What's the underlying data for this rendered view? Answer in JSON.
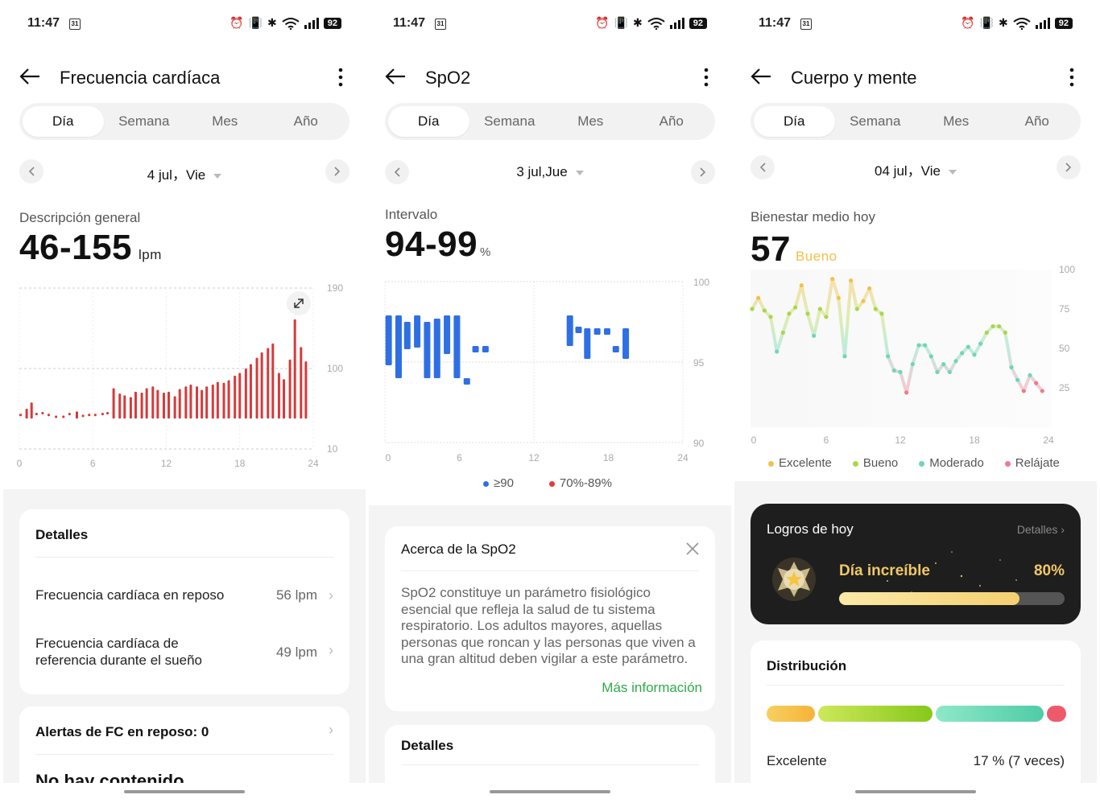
{
  "status": {
    "time": "11:47",
    "cal": "31",
    "battery": "92"
  },
  "screens": {
    "hr": {
      "title": "Frecuencia cardíaca",
      "tabs": [
        "Día",
        "Semana",
        "Mes",
        "Año"
      ],
      "date": "4 jul，Vie",
      "overview_label": "Descripción general",
      "range": "46-155",
      "unit": "lpm",
      "y_ticks": [
        "190",
        "100",
        "10"
      ],
      "x_ticks": [
        "0",
        "6",
        "12",
        "18",
        "24"
      ],
      "details_title": "Detalles",
      "rows": [
        {
          "label": "Frecuencia cardíaca en reposo",
          "value": "56 lpm"
        },
        {
          "label": "Frecuencia cardíaca de referencia durante el sueño",
          "value": "49 lpm"
        }
      ],
      "alerts_title": "Alertas de FC en reposo: 0",
      "no_content": "No hay contenido"
    },
    "spo2": {
      "title": "SpO2",
      "tabs": [
        "Día",
        "Semana",
        "Mes",
        "Año"
      ],
      "date": "3 jul,Jue",
      "interval_label": "Intervalo",
      "range": "94-99",
      "unit": "%",
      "y_ticks": [
        "100",
        "95",
        "90"
      ],
      "x_ticks": [
        "0",
        "6",
        "12",
        "18",
        "24"
      ],
      "legend": [
        {
          "label": "≥90",
          "color": "#2f6fe4"
        },
        {
          "label": "70%-89%",
          "color": "#e23b3b"
        }
      ],
      "about_title": "Acerca de la SpO2",
      "about_text": "SpO2 constituye un parámetro fisiológico esencial que refleja la salud de tu sistema respiratorio. Los adultos mayores, aquellas personas que roncan y las personas que viven a una gran altitud deben vigilar a este parámetro.",
      "more_info": "Más información",
      "details_title": "Detalles"
    },
    "body": {
      "title": "Cuerpo y mente",
      "tabs": [
        "Día",
        "Semana",
        "Mes",
        "Año"
      ],
      "date": "04 jul，Vie",
      "avg_label": "Bienestar medio hoy",
      "score": "57",
      "score_label": "Bueno",
      "y_ticks": [
        "100",
        "75",
        "50",
        "25"
      ],
      "x_ticks": [
        "0",
        "6",
        "12",
        "18",
        "24"
      ],
      "legend": [
        {
          "label": "Excelente",
          "color": "#f5c04a"
        },
        {
          "label": "Bueno",
          "color": "#a8d84a"
        },
        {
          "label": "Moderado",
          "color": "#6fd6b8"
        },
        {
          "label": "Relájate",
          "color": "#f07a8e"
        }
      ],
      "achievements_title": "Logros de hoy",
      "achievements_link": "Detalles",
      "achievement_name": "Día increíble",
      "achievement_pct": "80%",
      "achievement_progress": 0.8,
      "distribution_title": "Distribución",
      "distribution_row_label": "Excelente",
      "distribution_row_value": "17 % (7 veces)"
    }
  },
  "chart_data": [
    {
      "type": "bar",
      "ylim": [
        10,
        190
      ],
      "x_range": [
        0,
        24
      ],
      "values_note_points": [
        [
          0.1,
          48
        ],
        [
          0.6,
          55
        ],
        [
          1.0,
          62
        ],
        [
          1.4,
          49
        ],
        [
          1.9,
          50
        ],
        [
          2.4,
          48
        ],
        [
          3.0,
          46
        ],
        [
          3.6,
          46
        ],
        [
          4.1,
          49
        ],
        [
          4.7,
          52
        ],
        [
          5.2,
          47
        ],
        [
          5.7,
          48
        ],
        [
          6.2,
          48
        ],
        [
          6.8,
          49
        ],
        [
          7.2,
          50
        ],
        [
          7.7,
          78
        ],
        [
          8.2,
          72
        ],
        [
          8.6,
          70
        ],
        [
          9.1,
          68
        ],
        [
          9.5,
          74
        ],
        [
          10.0,
          73
        ],
        [
          10.4,
          78
        ],
        [
          10.9,
          80
        ],
        [
          11.3,
          76
        ],
        [
          11.8,
          73
        ],
        [
          12.2,
          74
        ],
        [
          12.7,
          69
        ],
        [
          13.1,
          77
        ],
        [
          13.6,
          80
        ],
        [
          14.0,
          82
        ],
        [
          14.5,
          80
        ],
        [
          14.9,
          76
        ],
        [
          15.3,
          80
        ],
        [
          15.8,
          82
        ],
        [
          16.2,
          85
        ],
        [
          16.7,
          84
        ],
        [
          17.1,
          87
        ],
        [
          17.6,
          92
        ],
        [
          18.0,
          95
        ],
        [
          18.5,
          100
        ],
        [
          18.9,
          105
        ],
        [
          19.4,
          112
        ],
        [
          19.8,
          118
        ],
        [
          20.3,
          123
        ],
        [
          20.7,
          128
        ],
        [
          21.2,
          95
        ],
        [
          21.6,
          88
        ],
        [
          22.1,
          110
        ],
        [
          22.5,
          155
        ],
        [
          23.0,
          124
        ],
        [
          23.4,
          108
        ]
      ]
    },
    {
      "type": "bar",
      "ylim": [
        90,
        100
      ],
      "x_range": [
        0,
        24
      ],
      "ranges": [
        [
          0.3,
          97.9,
          94.8
        ],
        [
          1.1,
          97.9,
          94.0
        ],
        [
          1.8,
          97.5,
          95.8
        ],
        [
          2.6,
          97.9,
          95.9
        ],
        [
          3.4,
          97.5,
          94.0
        ],
        [
          4.2,
          97.7,
          94.0
        ],
        [
          5.0,
          97.9,
          95.5
        ],
        [
          5.8,
          97.9,
          94.0
        ],
        [
          6.6,
          94.0,
          93.9
        ],
        [
          7.3,
          96.0,
          96.0
        ],
        [
          8.1,
          96.0,
          96.0
        ],
        [
          14.9,
          97.9,
          96.0
        ],
        [
          15.6,
          97.2,
          97.0
        ],
        [
          16.3,
          97.1,
          95.2
        ],
        [
          17.1,
          97.1,
          97.0
        ],
        [
          17.9,
          97.1,
          97.0
        ],
        [
          18.6,
          96.0,
          96.0
        ],
        [
          19.4,
          97.1,
          95.2
        ]
      ]
    },
    {
      "type": "line",
      "ylim": [
        0,
        100
      ],
      "x_range": [
        0,
        24
      ],
      "points": [
        [
          0.0,
          75
        ],
        [
          0.5,
          82
        ],
        [
          1.0,
          74
        ],
        [
          1.5,
          70
        ],
        [
          2.0,
          48
        ],
        [
          2.5,
          60
        ],
        [
          3.0,
          72
        ],
        [
          3.5,
          76
        ],
        [
          4.0,
          90
        ],
        [
          4.5,
          72
        ],
        [
          5.0,
          58
        ],
        [
          5.5,
          75
        ],
        [
          6.0,
          70
        ],
        [
          6.5,
          94
        ],
        [
          7.0,
          82
        ],
        [
          7.5,
          45
        ],
        [
          8.0,
          93
        ],
        [
          8.5,
          75
        ],
        [
          9.0,
          80
        ],
        [
          9.5,
          88
        ],
        [
          10.0,
          75
        ],
        [
          10.5,
          72
        ],
        [
          11.0,
          45
        ],
        [
          11.5,
          36
        ],
        [
          12.0,
          35
        ],
        [
          12.5,
          22
        ],
        [
          13.0,
          40
        ],
        [
          13.5,
          52
        ],
        [
          14.0,
          52
        ],
        [
          14.5,
          45
        ],
        [
          15.0,
          35
        ],
        [
          15.5,
          40
        ],
        [
          16.0,
          35
        ],
        [
          16.5,
          42
        ],
        [
          17.0,
          47
        ],
        [
          17.5,
          51
        ],
        [
          18.0,
          46
        ],
        [
          18.5,
          53
        ],
        [
          19.0,
          60
        ],
        [
          19.5,
          64
        ],
        [
          20.0,
          64
        ],
        [
          20.5,
          60
        ],
        [
          21.0,
          38
        ],
        [
          21.5,
          30
        ],
        [
          22.0,
          23
        ],
        [
          22.5,
          33
        ],
        [
          23.0,
          28
        ],
        [
          23.5,
          23
        ]
      ]
    }
  ]
}
